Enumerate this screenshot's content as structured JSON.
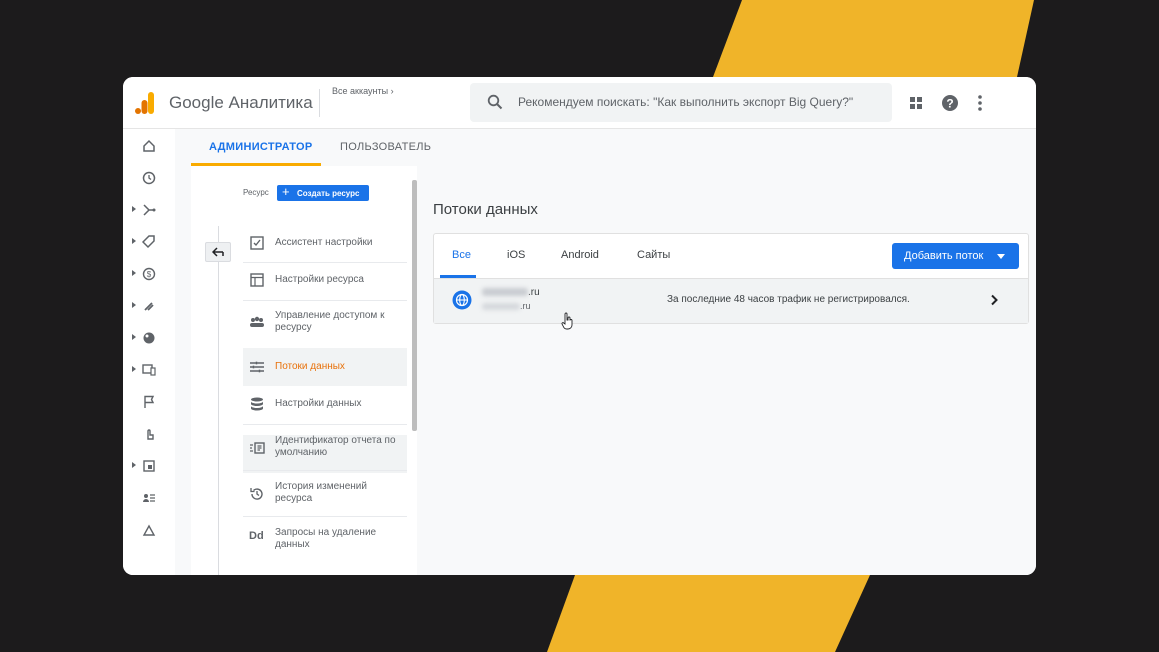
{
  "header": {
    "app_name": "Google Аналитика",
    "accounts_label": "Все аккаунты",
    "search_placeholder": "Рекомендуем поискать: \"Как выполнить экспорт Big Query?\""
  },
  "tabs": {
    "admin_label": "АДМИНИСТРАТОР",
    "user_label": "ПОЛЬЗОВАТЕЛЬ"
  },
  "nav": {
    "resource_label": "Ресурс",
    "create_resource_label": "Создать ресурс",
    "items": [
      {
        "label": "Ассистент настройки"
      },
      {
        "label": "Настройки ресурса"
      },
      {
        "label": "Управление доступом к ресурсу"
      },
      {
        "label": "Потоки данных"
      },
      {
        "label": "Настройки данных"
      },
      {
        "label": "Идентификатор отчета по умолчанию"
      },
      {
        "label": "История изменений ресурса"
      },
      {
        "label": "Запросы на удаление данных"
      }
    ]
  },
  "main": {
    "title": "Потоки данных",
    "filter_tabs": [
      {
        "label": "Все"
      },
      {
        "label": "iOS"
      },
      {
        "label": "Android"
      },
      {
        "label": "Сайты"
      }
    ],
    "add_stream_label": "Добавить поток",
    "stream": {
      "domain_suffix": ".ru",
      "url_suffix": ".ru",
      "status": "За последние 48 часов трафик не регистрировался."
    }
  },
  "colors": {
    "accent_blue": "#1a73e8",
    "active_orange": "#e8710a",
    "tab_underline": "#f9ab00",
    "stripe_yellow": "#f0b429"
  }
}
